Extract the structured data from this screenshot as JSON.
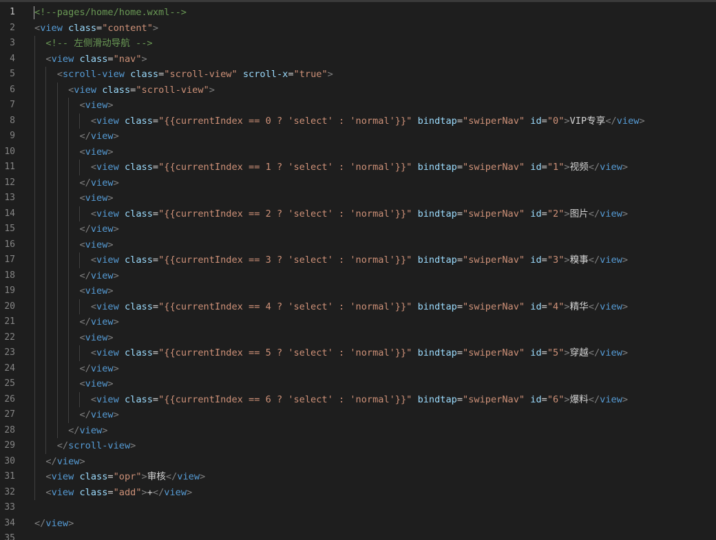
{
  "editor": {
    "lines": [
      [
        [
          "cm",
          "<!--pages/home/home.wxml-->"
        ]
      ],
      [
        [
          "pn",
          "<"
        ],
        [
          "tg",
          "view"
        ],
        [
          "tx",
          " "
        ],
        [
          "at",
          "class"
        ],
        [
          "tx",
          "="
        ],
        [
          "st",
          "\"content\""
        ],
        [
          "pn",
          ">"
        ]
      ],
      [
        [
          "tx",
          "  "
        ],
        [
          "cm",
          "<!-- 左侧滑动导航 -->"
        ]
      ],
      [
        [
          "tx",
          "  "
        ],
        [
          "pn",
          "<"
        ],
        [
          "tg",
          "view"
        ],
        [
          "tx",
          " "
        ],
        [
          "at",
          "class"
        ],
        [
          "tx",
          "="
        ],
        [
          "st",
          "\"nav\""
        ],
        [
          "pn",
          ">"
        ]
      ],
      [
        [
          "tx",
          "    "
        ],
        [
          "pn",
          "<"
        ],
        [
          "tg",
          "scroll-view"
        ],
        [
          "tx",
          " "
        ],
        [
          "at",
          "class"
        ],
        [
          "tx",
          "="
        ],
        [
          "st",
          "\"scroll-view\""
        ],
        [
          "tx",
          " "
        ],
        [
          "at",
          "scroll-x"
        ],
        [
          "tx",
          "="
        ],
        [
          "st",
          "\"true\""
        ],
        [
          "pn",
          ">"
        ]
      ],
      [
        [
          "tx",
          "      "
        ],
        [
          "pn",
          "<"
        ],
        [
          "tg",
          "view"
        ],
        [
          "tx",
          " "
        ],
        [
          "at",
          "class"
        ],
        [
          "tx",
          "="
        ],
        [
          "st",
          "\"scroll-view\""
        ],
        [
          "pn",
          ">"
        ]
      ],
      [
        [
          "tx",
          "        "
        ],
        [
          "pn",
          "<"
        ],
        [
          "tg",
          "view"
        ],
        [
          "pn",
          ">"
        ]
      ],
      [
        [
          "tx",
          "          "
        ],
        [
          "pn",
          "<"
        ],
        [
          "tg",
          "view"
        ],
        [
          "tx",
          " "
        ],
        [
          "at",
          "class"
        ],
        [
          "tx",
          "="
        ],
        [
          "st",
          "\"{{currentIndex == 0 ? 'select' : 'normal'}}\""
        ],
        [
          "tx",
          " "
        ],
        [
          "at",
          "bindtap"
        ],
        [
          "tx",
          "="
        ],
        [
          "st",
          "\"swiperNav\""
        ],
        [
          "tx",
          " "
        ],
        [
          "at",
          "id"
        ],
        [
          "tx",
          "="
        ],
        [
          "st",
          "\"0\""
        ],
        [
          "pn",
          ">"
        ],
        [
          "tx",
          "VIP专享"
        ],
        [
          "pn",
          "</"
        ],
        [
          "tg",
          "view"
        ],
        [
          "pn",
          ">"
        ]
      ],
      [
        [
          "tx",
          "        "
        ],
        [
          "pn",
          "</"
        ],
        [
          "tg",
          "view"
        ],
        [
          "pn",
          ">"
        ]
      ],
      [
        [
          "tx",
          "        "
        ],
        [
          "pn",
          "<"
        ],
        [
          "tg",
          "view"
        ],
        [
          "pn",
          ">"
        ]
      ],
      [
        [
          "tx",
          "          "
        ],
        [
          "pn",
          "<"
        ],
        [
          "tg",
          "view"
        ],
        [
          "tx",
          " "
        ],
        [
          "at",
          "class"
        ],
        [
          "tx",
          "="
        ],
        [
          "st",
          "\"{{currentIndex == 1 ? 'select' : 'normal'}}\""
        ],
        [
          "tx",
          " "
        ],
        [
          "at",
          "bindtap"
        ],
        [
          "tx",
          "="
        ],
        [
          "st",
          "\"swiperNav\""
        ],
        [
          "tx",
          " "
        ],
        [
          "at",
          "id"
        ],
        [
          "tx",
          "="
        ],
        [
          "st",
          "\"1\""
        ],
        [
          "pn",
          ">"
        ],
        [
          "tx",
          "视频"
        ],
        [
          "pn",
          "</"
        ],
        [
          "tg",
          "view"
        ],
        [
          "pn",
          ">"
        ]
      ],
      [
        [
          "tx",
          "        "
        ],
        [
          "pn",
          "</"
        ],
        [
          "tg",
          "view"
        ],
        [
          "pn",
          ">"
        ]
      ],
      [
        [
          "tx",
          "        "
        ],
        [
          "pn",
          "<"
        ],
        [
          "tg",
          "view"
        ],
        [
          "pn",
          ">"
        ]
      ],
      [
        [
          "tx",
          "          "
        ],
        [
          "pn",
          "<"
        ],
        [
          "tg",
          "view"
        ],
        [
          "tx",
          " "
        ],
        [
          "at",
          "class"
        ],
        [
          "tx",
          "="
        ],
        [
          "st",
          "\"{{currentIndex == 2 ? 'select' : 'normal'}}\""
        ],
        [
          "tx",
          " "
        ],
        [
          "at",
          "bindtap"
        ],
        [
          "tx",
          "="
        ],
        [
          "st",
          "\"swiperNav\""
        ],
        [
          "tx",
          " "
        ],
        [
          "at",
          "id"
        ],
        [
          "tx",
          "="
        ],
        [
          "st",
          "\"2\""
        ],
        [
          "pn",
          ">"
        ],
        [
          "tx",
          "图片"
        ],
        [
          "pn",
          "</"
        ],
        [
          "tg",
          "view"
        ],
        [
          "pn",
          ">"
        ]
      ],
      [
        [
          "tx",
          "        "
        ],
        [
          "pn",
          "</"
        ],
        [
          "tg",
          "view"
        ],
        [
          "pn",
          ">"
        ]
      ],
      [
        [
          "tx",
          "        "
        ],
        [
          "pn",
          "<"
        ],
        [
          "tg",
          "view"
        ],
        [
          "pn",
          ">"
        ]
      ],
      [
        [
          "tx",
          "          "
        ],
        [
          "pn",
          "<"
        ],
        [
          "tg",
          "view"
        ],
        [
          "tx",
          " "
        ],
        [
          "at",
          "class"
        ],
        [
          "tx",
          "="
        ],
        [
          "st",
          "\"{{currentIndex == 3 ? 'select' : 'normal'}}\""
        ],
        [
          "tx",
          " "
        ],
        [
          "at",
          "bindtap"
        ],
        [
          "tx",
          "="
        ],
        [
          "st",
          "\"swiperNav\""
        ],
        [
          "tx",
          " "
        ],
        [
          "at",
          "id"
        ],
        [
          "tx",
          "="
        ],
        [
          "st",
          "\"3\""
        ],
        [
          "pn",
          ">"
        ],
        [
          "tx",
          "糗事"
        ],
        [
          "pn",
          "</"
        ],
        [
          "tg",
          "view"
        ],
        [
          "pn",
          ">"
        ]
      ],
      [
        [
          "tx",
          "        "
        ],
        [
          "pn",
          "</"
        ],
        [
          "tg",
          "view"
        ],
        [
          "pn",
          ">"
        ]
      ],
      [
        [
          "tx",
          "        "
        ],
        [
          "pn",
          "<"
        ],
        [
          "tg",
          "view"
        ],
        [
          "pn",
          ">"
        ]
      ],
      [
        [
          "tx",
          "          "
        ],
        [
          "pn",
          "<"
        ],
        [
          "tg",
          "view"
        ],
        [
          "tx",
          " "
        ],
        [
          "at",
          "class"
        ],
        [
          "tx",
          "="
        ],
        [
          "st",
          "\"{{currentIndex == 4 ? 'select' : 'normal'}}\""
        ],
        [
          "tx",
          " "
        ],
        [
          "at",
          "bindtap"
        ],
        [
          "tx",
          "="
        ],
        [
          "st",
          "\"swiperNav\""
        ],
        [
          "tx",
          " "
        ],
        [
          "at",
          "id"
        ],
        [
          "tx",
          "="
        ],
        [
          "st",
          "\"4\""
        ],
        [
          "pn",
          ">"
        ],
        [
          "tx",
          "精华"
        ],
        [
          "pn",
          "</"
        ],
        [
          "tg",
          "view"
        ],
        [
          "pn",
          ">"
        ]
      ],
      [
        [
          "tx",
          "        "
        ],
        [
          "pn",
          "</"
        ],
        [
          "tg",
          "view"
        ],
        [
          "pn",
          ">"
        ]
      ],
      [
        [
          "tx",
          "        "
        ],
        [
          "pn",
          "<"
        ],
        [
          "tg",
          "view"
        ],
        [
          "pn",
          ">"
        ]
      ],
      [
        [
          "tx",
          "          "
        ],
        [
          "pn",
          "<"
        ],
        [
          "tg",
          "view"
        ],
        [
          "tx",
          " "
        ],
        [
          "at",
          "class"
        ],
        [
          "tx",
          "="
        ],
        [
          "st",
          "\"{{currentIndex == 5 ? 'select' : 'normal'}}\""
        ],
        [
          "tx",
          " "
        ],
        [
          "at",
          "bindtap"
        ],
        [
          "tx",
          "="
        ],
        [
          "st",
          "\"swiperNav\""
        ],
        [
          "tx",
          " "
        ],
        [
          "at",
          "id"
        ],
        [
          "tx",
          "="
        ],
        [
          "st",
          "\"5\""
        ],
        [
          "pn",
          ">"
        ],
        [
          "tx",
          "穿越"
        ],
        [
          "pn",
          "</"
        ],
        [
          "tg",
          "view"
        ],
        [
          "pn",
          ">"
        ]
      ],
      [
        [
          "tx",
          "        "
        ],
        [
          "pn",
          "</"
        ],
        [
          "tg",
          "view"
        ],
        [
          "pn",
          ">"
        ]
      ],
      [
        [
          "tx",
          "        "
        ],
        [
          "pn",
          "<"
        ],
        [
          "tg",
          "view"
        ],
        [
          "pn",
          ">"
        ]
      ],
      [
        [
          "tx",
          "          "
        ],
        [
          "pn",
          "<"
        ],
        [
          "tg",
          "view"
        ],
        [
          "tx",
          " "
        ],
        [
          "at",
          "class"
        ],
        [
          "tx",
          "="
        ],
        [
          "st",
          "\"{{currentIndex == 6 ? 'select' : 'normal'}}\""
        ],
        [
          "tx",
          " "
        ],
        [
          "at",
          "bindtap"
        ],
        [
          "tx",
          "="
        ],
        [
          "st",
          "\"swiperNav\""
        ],
        [
          "tx",
          " "
        ],
        [
          "at",
          "id"
        ],
        [
          "tx",
          "="
        ],
        [
          "st",
          "\"6\""
        ],
        [
          "pn",
          ">"
        ],
        [
          "tx",
          "爆料"
        ],
        [
          "pn",
          "</"
        ],
        [
          "tg",
          "view"
        ],
        [
          "pn",
          ">"
        ]
      ],
      [
        [
          "tx",
          "        "
        ],
        [
          "pn",
          "</"
        ],
        [
          "tg",
          "view"
        ],
        [
          "pn",
          ">"
        ]
      ],
      [
        [
          "tx",
          "      "
        ],
        [
          "pn",
          "</"
        ],
        [
          "tg",
          "view"
        ],
        [
          "pn",
          ">"
        ]
      ],
      [
        [
          "tx",
          "    "
        ],
        [
          "pn",
          "</"
        ],
        [
          "tg",
          "scroll-view"
        ],
        [
          "pn",
          ">"
        ]
      ],
      [
        [
          "tx",
          "  "
        ],
        [
          "pn",
          "</"
        ],
        [
          "tg",
          "view"
        ],
        [
          "pn",
          ">"
        ]
      ],
      [
        [
          "tx",
          "  "
        ],
        [
          "pn",
          "<"
        ],
        [
          "tg",
          "view"
        ],
        [
          "tx",
          " "
        ],
        [
          "at",
          "class"
        ],
        [
          "tx",
          "="
        ],
        [
          "st",
          "\"opr\""
        ],
        [
          "pn",
          ">"
        ],
        [
          "tx",
          "审核"
        ],
        [
          "pn",
          "</"
        ],
        [
          "tg",
          "view"
        ],
        [
          "pn",
          ">"
        ]
      ],
      [
        [
          "tx",
          "  "
        ],
        [
          "pn",
          "<"
        ],
        [
          "tg",
          "view"
        ],
        [
          "tx",
          " "
        ],
        [
          "at",
          "class"
        ],
        [
          "tx",
          "="
        ],
        [
          "st",
          "\"add\""
        ],
        [
          "pn",
          ">"
        ],
        [
          "tx",
          "+"
        ],
        [
          "pn",
          "</"
        ],
        [
          "tg",
          "view"
        ],
        [
          "pn",
          ">"
        ]
      ],
      [],
      [
        [
          "pn",
          "</"
        ],
        [
          "tg",
          "view"
        ],
        [
          "pn",
          ">"
        ]
      ],
      []
    ],
    "active_line": 1
  },
  "colors": {
    "background": "#1e1e1e",
    "comment": "#6a9955",
    "punctuation": "#808080",
    "tag": "#569cd6",
    "attribute": "#9cdcfe",
    "string": "#ce9178",
    "text": "#d4d4d4",
    "line_number": "#858585"
  }
}
